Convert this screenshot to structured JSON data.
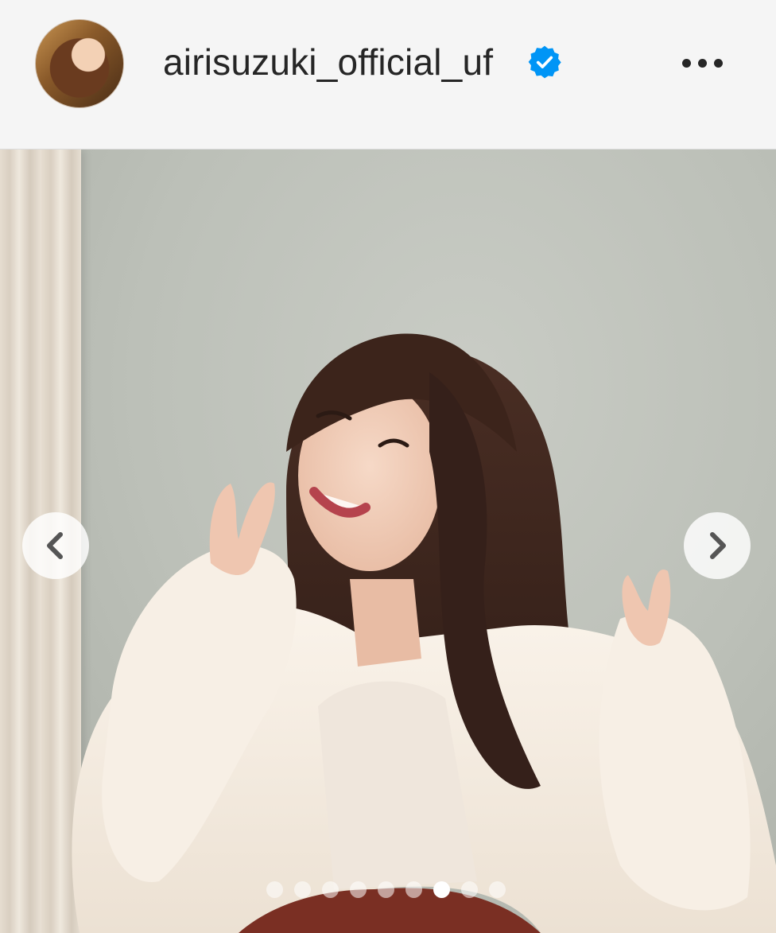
{
  "header": {
    "username": "airisuzuki_official_uf",
    "verified": true,
    "avatar_icon": "profile-avatar",
    "more_icon": "more-options-icon"
  },
  "post": {
    "image_icon": "photo",
    "carousel": {
      "total": 9,
      "active_index": 6
    },
    "prev_icon": "chevron-left-icon",
    "next_icon": "chevron-right-icon"
  },
  "colors": {
    "verified_blue": "#0095f6",
    "text": "#262626",
    "header_bg": "#f5f5f5"
  }
}
